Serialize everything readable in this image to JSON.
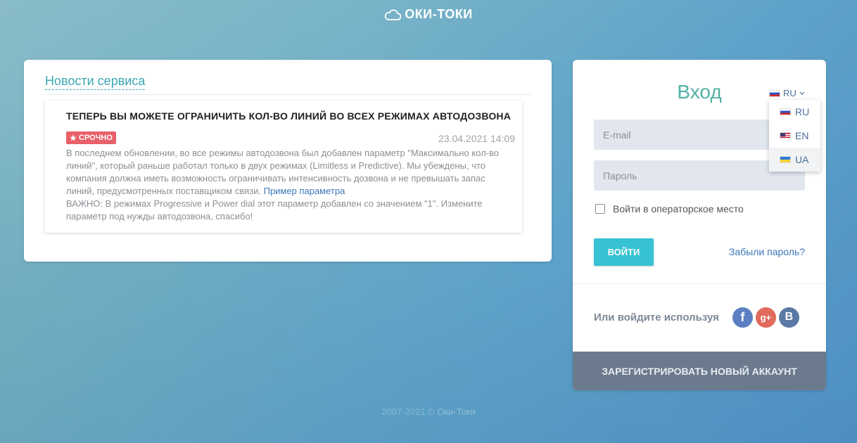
{
  "logo": {
    "text": "ОКИ-ТОКИ",
    "icon": "cloud-icon"
  },
  "news": {
    "heading": "Новости сервиса",
    "item": {
      "title": "ТЕПЕРЬ ВЫ МОЖЕТЕ ОГРАНИЧИТЬ КОЛ-ВО ЛИНИЙ ВО ВСЕХ РЕЖИМАХ АВТОДОЗВОНА",
      "badge": "СРОЧНО",
      "date": "23.04.2021 14:09",
      "body": "В последнем обновлении, во все режимы автодозвона был добавлен параметр \"Максимально кол-во линий\", который раньше работал только в двух режимах (Limitless и Predictive). Мы убеждены, что компания должна иметь возможность ограничивать интенсивность дозвона и не превышать запас линий, предусмотренных поставщиком связи.",
      "link": "Пример параметра",
      "note": "ВАЖНО: В режимах Progressive и Power dial этот параметр добавлен со значением \"1\". Измените параметр под нужды автодозвона, спасибо!"
    }
  },
  "login": {
    "heading": "Вход",
    "language": {
      "current": "RU",
      "options": [
        "RU",
        "EN",
        "UA"
      ]
    },
    "email_placeholder": "E-mail",
    "password_placeholder": "Пароль",
    "operator_label": "Войти в операторское место",
    "submit_label": "ВОЙТИ",
    "forgot_label": "Забыли пароль?",
    "social_label": "Или войдите используя",
    "social": {
      "facebook": "f",
      "google": "g+",
      "vk": "B"
    },
    "register_label": "ЗАРЕГИСТРИРОВАТЬ НОВЫЙ АККАУНТ"
  },
  "footer": {
    "years": "2007-2021 ©",
    "brand": "Оки-Токи"
  },
  "colors": {
    "accent": "#36c2d3",
    "heading": "#52b2a5",
    "urgent": "#e8606a",
    "register": "#6b7b8d"
  }
}
